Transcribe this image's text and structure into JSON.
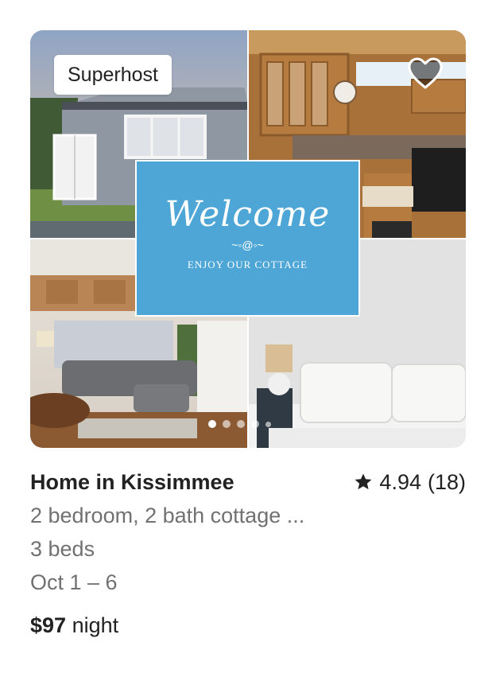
{
  "listing": {
    "badge": "Superhost",
    "title": "Home in Kissimmee",
    "rating": "4.94",
    "reviews": "(18)",
    "description": "2 bedroom, 2 bath cottage ...",
    "beds": "3 beds",
    "dates": "Oct 1 – 6",
    "price": "$97",
    "price_unit": "night"
  },
  "photo": {
    "welcome_title": "Welcome",
    "welcome_ornament": "~◦@◦~",
    "welcome_subtitle": "ENJOY OUR COTTAGE",
    "carousel_total": 5,
    "carousel_active": 1
  },
  "icons": {
    "heart": "heart-icon",
    "star": "star-icon"
  },
  "colors": {
    "welcome_bg": "#4da6d6",
    "text_primary": "#222222",
    "text_secondary": "#717171"
  }
}
